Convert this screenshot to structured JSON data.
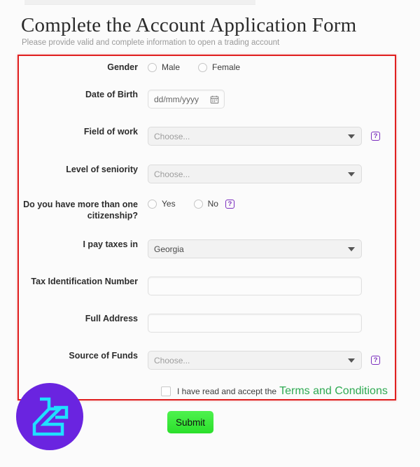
{
  "header": {
    "title": "Complete the Account Application Form",
    "subtitle": "Please provide valid and complete information to open a trading account"
  },
  "colors": {
    "highlight_border": "#e02020",
    "help_icon": "#7b2fbe",
    "terms_link": "#2faa52",
    "submit_button": "#2bdf2b",
    "logo_circle": "#6a24e0",
    "logo_mark": "#1fe0ff"
  },
  "form": {
    "gender": {
      "label": "Gender",
      "options": [
        {
          "label": "Male",
          "checked": false
        },
        {
          "label": "Female",
          "checked": false
        }
      ]
    },
    "date_of_birth": {
      "label": "Date of Birth",
      "placeholder": "dd/mm/yyyy",
      "value": "",
      "icon": "calendar-icon"
    },
    "field_of_work": {
      "label": "Field of work",
      "value": "Choose...",
      "selected": false,
      "help": "?"
    },
    "level_of_seniority": {
      "label": "Level of seniority",
      "value": "Choose...",
      "selected": false
    },
    "citizenship": {
      "label_line1": "Do you have more than one",
      "label_line2": "citizenship?",
      "options": [
        {
          "label": "Yes",
          "checked": false
        },
        {
          "label": "No",
          "checked": false
        }
      ],
      "help": "?"
    },
    "tax_country": {
      "label": "I pay taxes in",
      "value": "Georgia",
      "selected": true
    },
    "tax_id": {
      "label": "Tax Identification Number",
      "value": "",
      "placeholder": ""
    },
    "full_address": {
      "label": "Full Address",
      "value": "",
      "placeholder": ""
    },
    "source_of_funds": {
      "label": "Source of Funds",
      "value": "Choose...",
      "selected": false,
      "help": "?"
    },
    "terms": {
      "text": "I have read and accept the",
      "link": "Terms and Conditions",
      "checked": false
    },
    "submit": {
      "label": "Submit"
    }
  }
}
